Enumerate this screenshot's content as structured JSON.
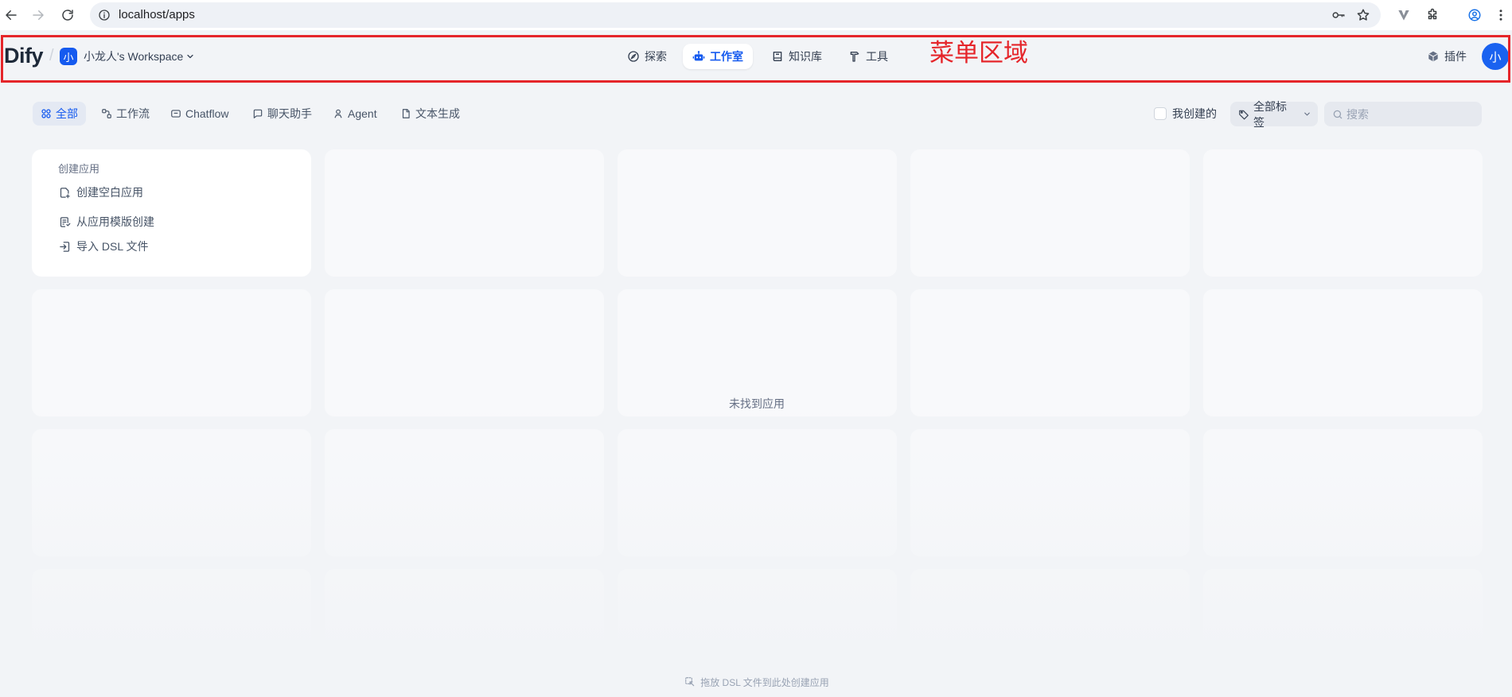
{
  "browser": {
    "url": "localhost/apps",
    "icons": [
      "back-icon",
      "forward-icon",
      "reload-icon",
      "info-icon",
      "key-icon",
      "star-icon",
      "extension-v-icon",
      "puzzle-icon",
      "profile-icon",
      "kebab-menu-icon"
    ]
  },
  "header": {
    "logo": "Dify",
    "separator": "/",
    "workspace": {
      "avatar": "小",
      "name": "小龙人's Workspace"
    },
    "nav": [
      {
        "label": "探索",
        "icon": "compass-icon",
        "active": false
      },
      {
        "label": "工作室",
        "icon": "robot-icon",
        "active": true
      },
      {
        "label": "知识库",
        "icon": "book-icon",
        "active": false
      },
      {
        "label": "工具",
        "icon": "hammer-icon",
        "active": false
      }
    ],
    "plugins": {
      "label": "插件",
      "icon": "cube-icon"
    },
    "user_avatar": "小"
  },
  "annotation": {
    "label": "菜单区域",
    "color": "#e5252a"
  },
  "filters": {
    "tabs": [
      {
        "label": "全部",
        "icon": "grid-icon",
        "active": true
      },
      {
        "label": "工作流",
        "icon": "workflow-icon",
        "active": false
      },
      {
        "label": "Chatflow",
        "icon": "chatflow-icon",
        "active": false
      },
      {
        "label": "聊天助手",
        "icon": "chat-icon",
        "active": false
      },
      {
        "label": "Agent",
        "icon": "agent-icon",
        "active": false
      },
      {
        "label": "文本生成",
        "icon": "document-icon",
        "active": false
      }
    ],
    "created_by_me": {
      "label": "我创建的",
      "checked": false
    },
    "tags": {
      "label": "全部标签"
    },
    "search_placeholder": "搜索"
  },
  "create_card": {
    "title": "创建应用",
    "items": [
      {
        "label": "创建空白应用",
        "icon": "file-plus-icon"
      },
      {
        "label": "从应用模版创建",
        "icon": "file-template-icon"
      },
      {
        "label": "导入 DSL 文件",
        "icon": "import-file-icon"
      }
    ]
  },
  "empty_state": "未找到应用",
  "drop_hint": "拖放 DSL 文件到此处创建应用",
  "colors": {
    "accent": "#155aef",
    "background": "#f2f4f7",
    "annotation": "#e5252a"
  }
}
